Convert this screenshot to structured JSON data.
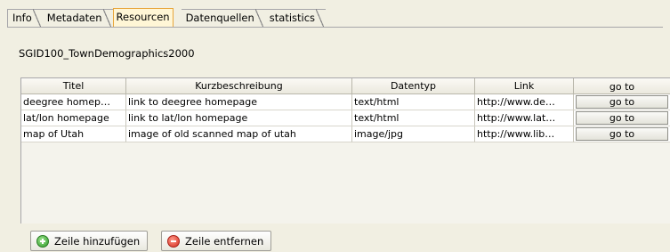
{
  "tabs": [
    {
      "label": "Info",
      "active": false
    },
    {
      "label": "Metadaten",
      "active": false
    },
    {
      "label": "Resourcen",
      "active": true
    },
    {
      "label": "Datenquellen",
      "active": false
    },
    {
      "label": "statistics",
      "active": false
    }
  ],
  "dataset_title": "SGID100_TownDemographics2000",
  "table": {
    "headers": [
      "Titel",
      "Kurzbeschreibung",
      "Datentyp",
      "Link",
      "go to"
    ],
    "rows": [
      {
        "titel": "deegree homep…",
        "beschreibung": "link to deegree homepage",
        "datentyp": "text/html",
        "link": "http://www.de…",
        "goto": "go to"
      },
      {
        "titel": "lat/lon homepage",
        "beschreibung": "link to lat/lon homepage",
        "datentyp": "text/html",
        "link": "http://www.lat…",
        "goto": "go to"
      },
      {
        "titel": "map of Utah",
        "beschreibung": "image of old scanned map of utah",
        "datentyp": "image/jpg",
        "link": "http://www.lib…",
        "goto": "go to"
      }
    ]
  },
  "buttons": {
    "add_row": "Zeile hinzufügen",
    "remove_row": "Zeile entfernen"
  },
  "icons": {
    "add": "plus-circle-icon",
    "remove": "minus-circle-icon"
  },
  "colors": {
    "active_tab_border": "#e8a53a",
    "active_tab_bg": "#fff6d6",
    "panel_bg": "#f1efe2"
  }
}
